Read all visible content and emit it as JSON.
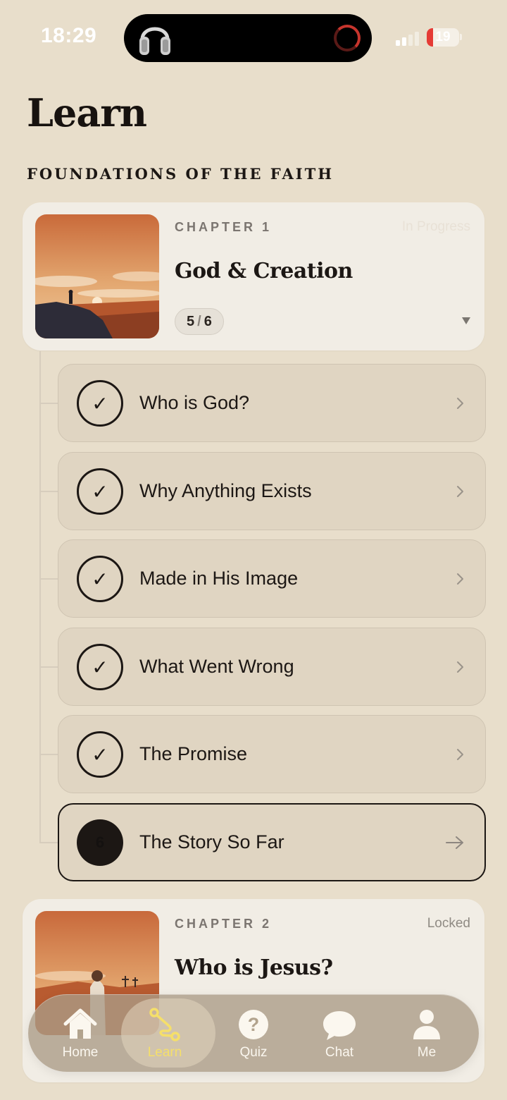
{
  "status_bar": {
    "time": "18:29",
    "battery_level": "19",
    "battery_fraction": 0.19
  },
  "header": {
    "title": "Learn",
    "section": "FOUNDATIONS OF THE FAITH"
  },
  "chapters": [
    {
      "label": "CHAPTER 1",
      "status": "In Progress",
      "title": "God & Creation",
      "progress_done": "5",
      "progress_sep": "/",
      "progress_total": "6",
      "expanded": true
    },
    {
      "label": "CHAPTER 2",
      "status": "Locked",
      "title": "Who is Jesus?"
    }
  ],
  "lessons": [
    {
      "title": "Who is God?",
      "completed": true,
      "check": "✓"
    },
    {
      "title": "Why Anything Exists",
      "completed": true,
      "check": "✓"
    },
    {
      "title": "Made in His Image",
      "completed": true,
      "check": "✓"
    },
    {
      "title": "What Went Wrong",
      "completed": true,
      "check": "✓"
    },
    {
      "title": "The Promise",
      "completed": true,
      "check": "✓"
    },
    {
      "title": "The Story So Far",
      "completed": false,
      "number": "6",
      "current": true
    }
  ],
  "tabs": [
    {
      "label": "Home",
      "icon": "home-icon"
    },
    {
      "label": "Learn",
      "icon": "route-icon",
      "active": true
    },
    {
      "label": "Quiz",
      "icon": "question-icon"
    },
    {
      "label": "Chat",
      "icon": "chat-bubble-icon"
    },
    {
      "label": "Me",
      "icon": "person-icon"
    }
  ],
  "colors": {
    "background": "#e8decb",
    "card": "#f1ede5",
    "lesson": "#e0d5c2",
    "ink": "#1c1714",
    "active_tab": "#f5df6a",
    "battery_low": "#e53b35"
  }
}
